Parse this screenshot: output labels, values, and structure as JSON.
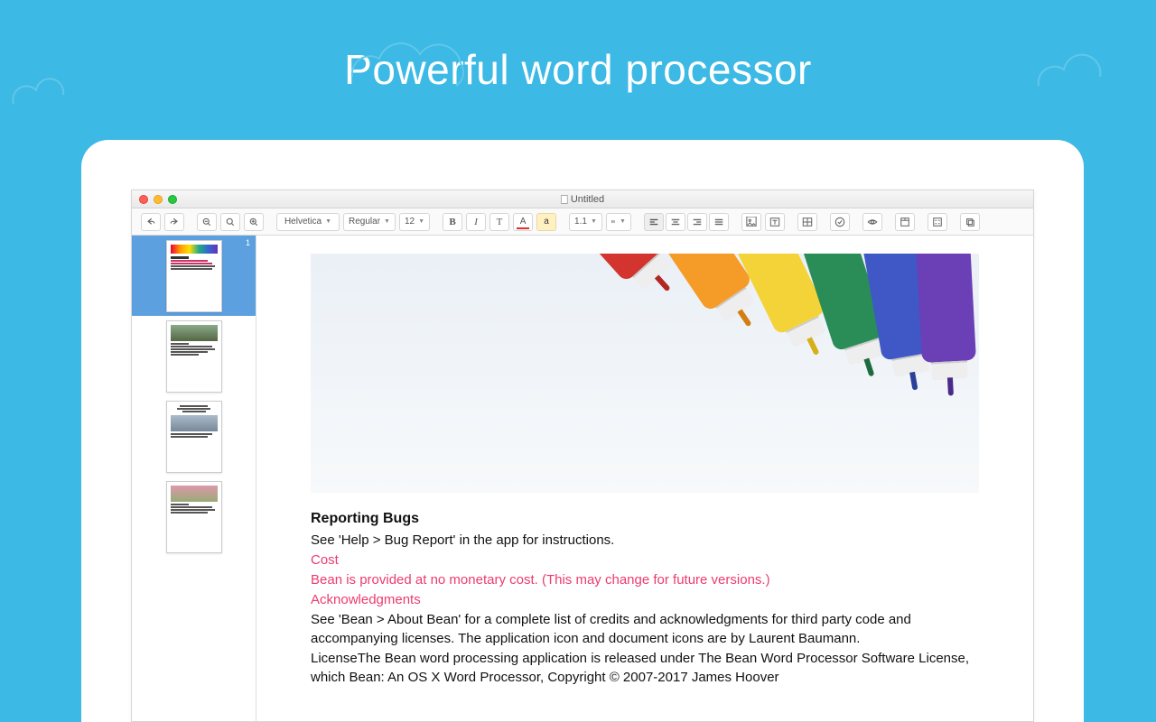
{
  "hero": {
    "title": "Powerful word processor"
  },
  "window": {
    "title": "Untitled"
  },
  "toolbar": {
    "font": "Helvetica",
    "weight": "Regular",
    "size": "12",
    "lineheight": "1.1",
    "bold": "B",
    "italic": "I",
    "textformat": "T",
    "fontcolor": "A",
    "highlight": "a"
  },
  "sidebar": {
    "page1": "1"
  },
  "document": {
    "h1": "Reporting Bugs",
    "p1": "See 'Help > Bug Report' in the app for instructions.",
    "p2": "Cost",
    "p3": "Bean is provided at no monetary cost. (This may change for future versions.)",
    "p4": "Acknowledgments",
    "p5": "See 'Bean > About Bean' for a complete list of credits and acknowledgments for third party code and accompanying licenses. The application icon and document icons are by Laurent Baumann.",
    "p6": "LicenseThe Bean word processing application is released under The Bean Word Processor Software License, which Bean: An OS X Word Processor, Copyright © 2007-2017 James Hoover"
  },
  "colors": {
    "markers": [
      "#d4342e",
      "#f59b28",
      "#f4d339",
      "#2a8d58",
      "#3f58c5",
      "#6b3fb5"
    ],
    "nibs": [
      "#b12822",
      "#d37e12",
      "#d6b017",
      "#1d6a3e",
      "#2c409a",
      "#4c2a8a"
    ]
  }
}
